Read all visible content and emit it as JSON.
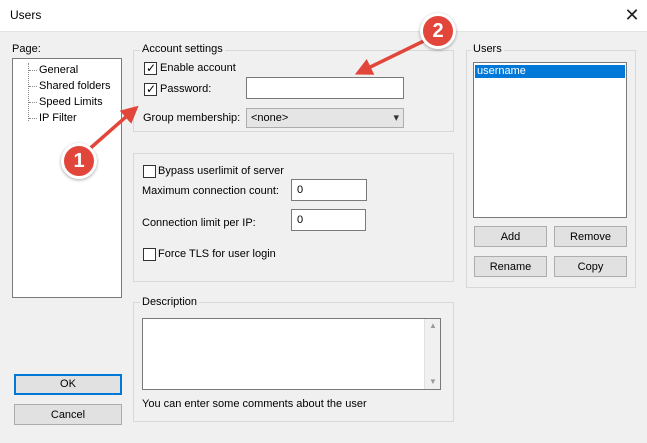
{
  "window": {
    "title": "Users",
    "close_glyph": "✕"
  },
  "page_panel": {
    "label": "Page:",
    "items": [
      "General",
      "Shared folders",
      "Speed Limits",
      "IP Filter"
    ]
  },
  "account_settings": {
    "group_label": "Account settings",
    "enable_account_label": "Enable account",
    "enable_account_checked": true,
    "password_label": "Password:",
    "password_checked": true,
    "password_value": "",
    "group_membership_label": "Group membership:",
    "group_membership_value": "<none>"
  },
  "limits": {
    "bypass_label": "Bypass userlimit of server",
    "bypass_checked": false,
    "max_conn_label": "Maximum connection count:",
    "max_conn_value": "0",
    "conn_limit_ip_label": "Connection limit per IP:",
    "conn_limit_ip_value": "0",
    "force_tls_label": "Force TLS for user login",
    "force_tls_checked": false
  },
  "description": {
    "group_label": "Description",
    "text_value": "",
    "hint": "You can enter some comments about the user"
  },
  "users_panel": {
    "group_label": "Users",
    "items": [
      "username"
    ],
    "add_label": "Add",
    "remove_label": "Remove",
    "rename_label": "Rename",
    "copy_label": "Copy"
  },
  "footer": {
    "ok_label": "OK",
    "cancel_label": "Cancel"
  },
  "annotations": {
    "badge1": "1",
    "badge2": "2",
    "arrow_color": "#e2463a"
  }
}
